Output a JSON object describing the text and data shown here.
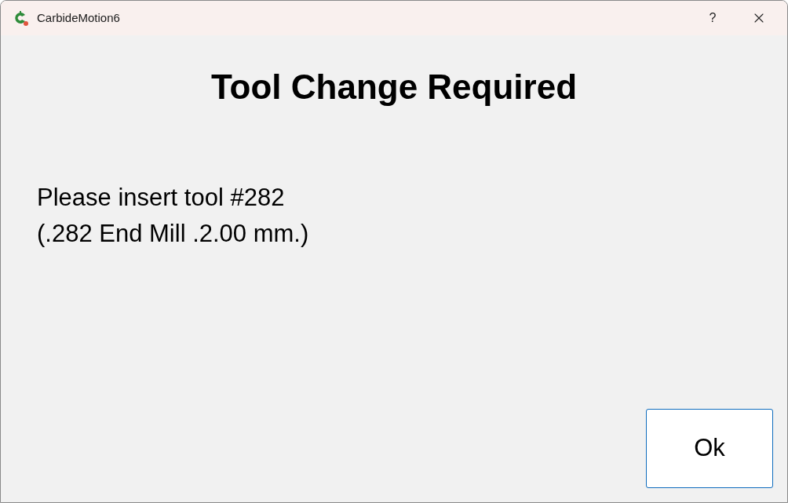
{
  "window": {
    "title": "CarbideMotion6",
    "help": "?"
  },
  "heading": "Tool Change Required",
  "message": [
    "Please insert tool #282",
    "(.282 End Mill .2.00 mm.)"
  ],
  "buttons": [
    "Ok"
  ]
}
